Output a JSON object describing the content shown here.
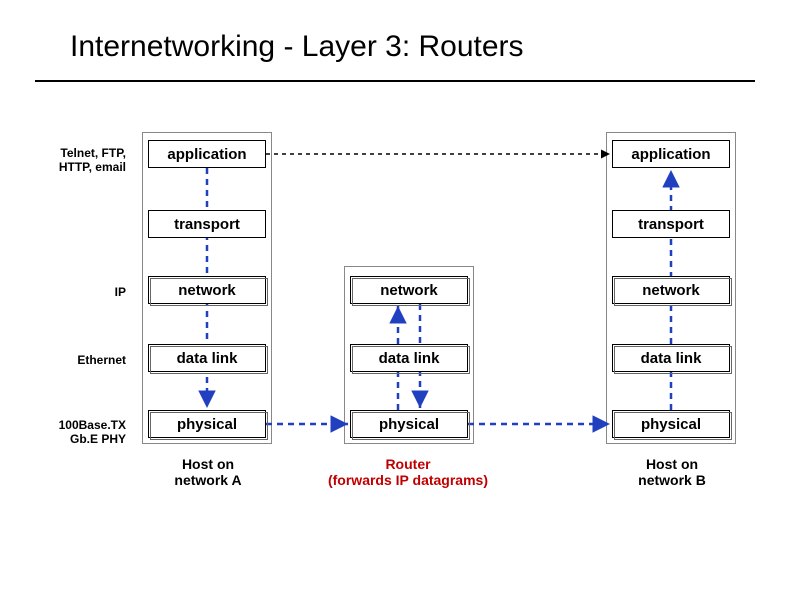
{
  "title": "Internetworking - Layer 3: Routers",
  "labels": {
    "protocols": "Telnet, FTP,\nHTTP, email",
    "ip": "IP",
    "ethernet": "Ethernet",
    "phy": "100Base.TX\nGb.E PHY"
  },
  "layers": {
    "application": "application",
    "transport": "transport",
    "network": "network",
    "datalink": "data link",
    "physical": "physical"
  },
  "captions": {
    "hostA": "Host on\nnetwork A",
    "router": "Router\n(forwards IP datagrams)",
    "hostB": "Host on\nnetwork B"
  },
  "chart_data": {
    "type": "diagram",
    "title": "Internetworking - Layer 3: Routers",
    "nodes": [
      {
        "id": "hostA",
        "caption": "Host on network A",
        "layers": [
          "application",
          "transport",
          "network",
          "data link",
          "physical"
        ],
        "labels_left": {
          "application": "Telnet, FTP, HTTP, email",
          "network": "IP",
          "data link": "Ethernet",
          "physical": "100Base.TX Gb.E PHY"
        }
      },
      {
        "id": "router",
        "caption": "Router (forwards IP datagrams)",
        "layers": [
          "network",
          "data link",
          "physical"
        ]
      },
      {
        "id": "hostB",
        "caption": "Host on network B",
        "layers": [
          "application",
          "transport",
          "network",
          "data link",
          "physical"
        ]
      }
    ],
    "edges": [
      {
        "from": "hostA",
        "to": "hostB",
        "layer": "application",
        "style": "dashed-black"
      },
      {
        "from": "hostA.physical",
        "to": "router.physical",
        "style": "dashed-blue"
      },
      {
        "from": "router.physical",
        "to": "hostB.physical",
        "style": "dashed-blue"
      },
      {
        "from": "hostA.application",
        "to": "hostA.physical",
        "direction": "down",
        "style": "dashed-blue"
      },
      {
        "from": "router.physical",
        "to": "router.network",
        "direction": "up",
        "style": "dashed-blue",
        "side": "left"
      },
      {
        "from": "router.network",
        "to": "router.physical",
        "direction": "down",
        "style": "dashed-blue",
        "side": "right"
      },
      {
        "from": "hostB.physical",
        "to": "hostB.application",
        "direction": "up",
        "style": "dashed-blue"
      }
    ]
  }
}
